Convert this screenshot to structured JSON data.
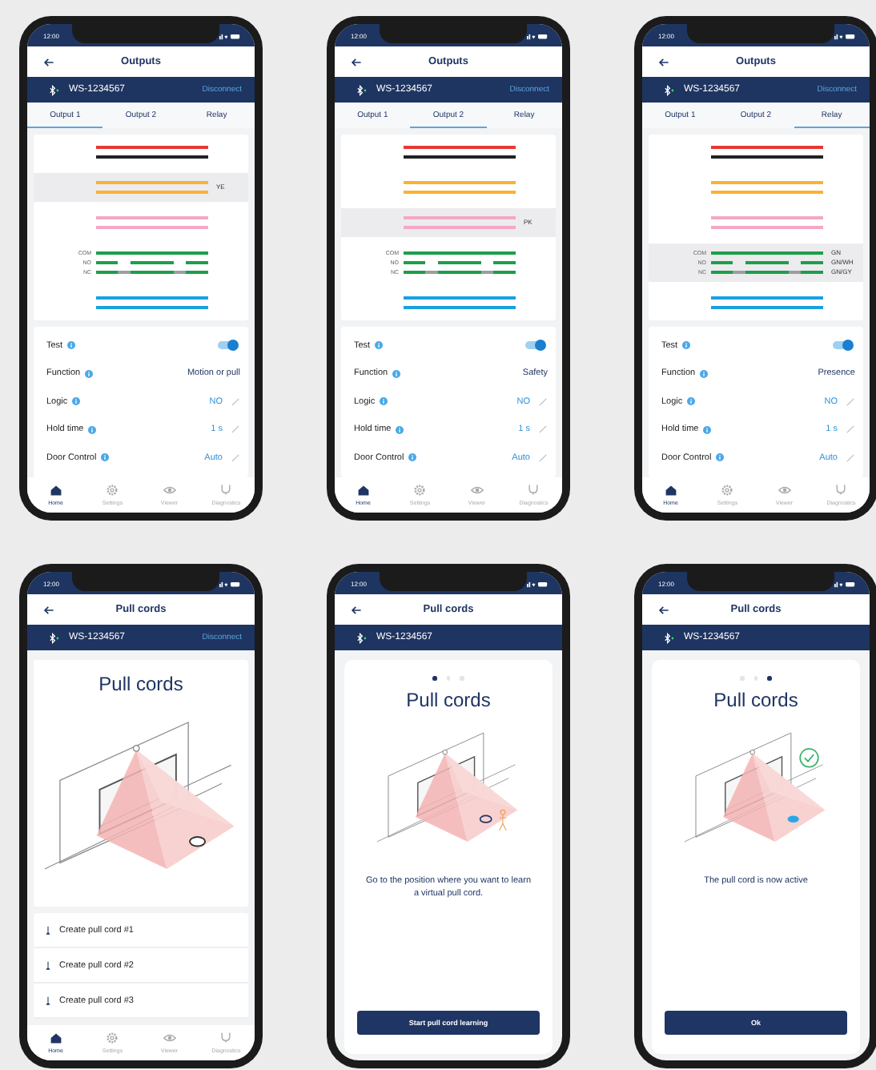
{
  "phones": [
    {
      "kind": "outputs",
      "status_time": "12:00",
      "title": "Outputs",
      "device": "WS-1234567",
      "disconnect": "Disconnect",
      "tabs": [
        {
          "label": "Output 1",
          "selected": true
        },
        {
          "label": "Output 2",
          "selected": false
        },
        {
          "label": "Relay",
          "selected": false
        }
      ],
      "wire_groups": [
        {
          "highlighted": false,
          "lines": [
            {
              "color": "#e53935",
              "kind": "solid"
            },
            {
              "color": "#222222",
              "kind": "solid"
            }
          ]
        },
        {
          "highlighted": true,
          "tags": [
            "YE"
          ],
          "lines": [
            {
              "color": "#f9b233",
              "kind": "solid"
            },
            {
              "color": "#f9b233",
              "kind": "solid"
            }
          ]
        },
        {
          "highlighted": false,
          "lines": [
            {
              "color": "#f4a7c6",
              "kind": "solid"
            },
            {
              "color": "#f4a7c6",
              "kind": "solid"
            }
          ]
        },
        {
          "highlighted": false,
          "lines": [
            {
              "color": "#1e9e4a",
              "kind": "solid",
              "label": "COM"
            },
            {
              "color": "#1e9e4a",
              "kind": "break",
              "label": "NO"
            },
            {
              "color": "#1e9e4a",
              "kind": "grey-break",
              "label": "NC"
            }
          ]
        },
        {
          "highlighted": false,
          "lines": [
            {
              "color": "#1aa0e0",
              "kind": "solid"
            },
            {
              "color": "#1aa0e0",
              "kind": "solid"
            }
          ]
        }
      ],
      "settings": [
        {
          "label": "Test",
          "kind": "toggle",
          "on": true
        },
        {
          "label": "Function",
          "kind": "value",
          "value": "Motion or pull"
        },
        {
          "label": "Logic",
          "kind": "edit",
          "value": "NO"
        },
        {
          "label": "Hold time",
          "kind": "edit",
          "value": "1 s"
        },
        {
          "label": "Door Control",
          "kind": "edit",
          "value": "Auto"
        }
      ],
      "nav": [
        {
          "label": "Home",
          "selected": true
        },
        {
          "label": "Settings",
          "selected": false
        },
        {
          "label": "Viewer",
          "selected": false
        },
        {
          "label": "Diagnostics",
          "selected": false
        }
      ]
    },
    {
      "kind": "outputs",
      "status_time": "12:00",
      "title": "Outputs",
      "device": "WS-1234567",
      "disconnect": "Disconnect",
      "tabs": [
        {
          "label": "Output 1",
          "selected": false
        },
        {
          "label": "Output 2",
          "selected": true
        },
        {
          "label": "Relay",
          "selected": false
        }
      ],
      "wire_groups": [
        {
          "highlighted": false,
          "lines": [
            {
              "color": "#e53935",
              "kind": "solid"
            },
            {
              "color": "#222222",
              "kind": "solid"
            }
          ]
        },
        {
          "highlighted": false,
          "lines": [
            {
              "color": "#f9b233",
              "kind": "solid"
            },
            {
              "color": "#f9b233",
              "kind": "solid"
            }
          ]
        },
        {
          "highlighted": true,
          "tags": [
            "PK"
          ],
          "lines": [
            {
              "color": "#f4a7c6",
              "kind": "solid"
            },
            {
              "color": "#f4a7c6",
              "kind": "solid"
            }
          ]
        },
        {
          "highlighted": false,
          "lines": [
            {
              "color": "#1e9e4a",
              "kind": "solid",
              "label": "COM"
            },
            {
              "color": "#1e9e4a",
              "kind": "break",
              "label": "NO"
            },
            {
              "color": "#1e9e4a",
              "kind": "grey-break",
              "label": "NC"
            }
          ]
        },
        {
          "highlighted": false,
          "lines": [
            {
              "color": "#1aa0e0",
              "kind": "solid"
            },
            {
              "color": "#1aa0e0",
              "kind": "solid"
            }
          ]
        }
      ],
      "settings": [
        {
          "label": "Test",
          "kind": "toggle",
          "on": true
        },
        {
          "label": "Function",
          "kind": "value",
          "value": "Safety"
        },
        {
          "label": "Logic",
          "kind": "edit",
          "value": "NO"
        },
        {
          "label": "Hold time",
          "kind": "edit",
          "value": "1 s"
        },
        {
          "label": "Door Control",
          "kind": "edit",
          "value": "Auto"
        }
      ],
      "nav": [
        {
          "label": "Home",
          "selected": true
        },
        {
          "label": "Settings",
          "selected": false
        },
        {
          "label": "Viewer",
          "selected": false
        },
        {
          "label": "Diagnostics",
          "selected": false
        }
      ]
    },
    {
      "kind": "outputs",
      "status_time": "12:00",
      "title": "Outputs",
      "device": "WS-1234567",
      "disconnect": "Disconnect",
      "tabs": [
        {
          "label": "Output 1",
          "selected": false
        },
        {
          "label": "Output 2",
          "selected": false
        },
        {
          "label": "Relay",
          "selected": true
        }
      ],
      "wire_groups": [
        {
          "highlighted": false,
          "lines": [
            {
              "color": "#e53935",
              "kind": "solid"
            },
            {
              "color": "#222222",
              "kind": "solid"
            }
          ]
        },
        {
          "highlighted": false,
          "lines": [
            {
              "color": "#f9b233",
              "kind": "solid"
            },
            {
              "color": "#f9b233",
              "kind": "solid"
            }
          ]
        },
        {
          "highlighted": false,
          "lines": [
            {
              "color": "#f4a7c6",
              "kind": "solid"
            },
            {
              "color": "#f4a7c6",
              "kind": "solid"
            }
          ]
        },
        {
          "highlighted": true,
          "tags": [
            "GN",
            "GN/WH",
            "GN/GY"
          ],
          "lines": [
            {
              "color": "#1e9e4a",
              "kind": "solid",
              "label": "COM"
            },
            {
              "color": "#1e9e4a",
              "kind": "break",
              "label": "NO"
            },
            {
              "color": "#1e9e4a",
              "kind": "grey-break",
              "label": "NC"
            }
          ]
        },
        {
          "highlighted": false,
          "lines": [
            {
              "color": "#1aa0e0",
              "kind": "solid"
            },
            {
              "color": "#1aa0e0",
              "kind": "solid"
            }
          ]
        }
      ],
      "settings": [
        {
          "label": "Test",
          "kind": "toggle",
          "on": true
        },
        {
          "label": "Function",
          "kind": "value",
          "value": "Presence"
        },
        {
          "label": "Logic",
          "kind": "edit",
          "value": "NO"
        },
        {
          "label": "Hold time",
          "kind": "edit",
          "value": "1 s"
        },
        {
          "label": "Door Control",
          "kind": "edit",
          "value": "Auto"
        }
      ],
      "nav": [
        {
          "label": "Home",
          "selected": true
        },
        {
          "label": "Settings",
          "selected": false
        },
        {
          "label": "Viewer",
          "selected": false
        },
        {
          "label": "Diagnostics",
          "selected": false
        }
      ]
    },
    {
      "kind": "pull-list",
      "status_time": "12:00",
      "title": "Pull cords",
      "device": "WS-1234567",
      "disconnect": "Disconnect",
      "heading": "Pull cords",
      "illustration": {
        "kind": "ring"
      },
      "items": [
        "Create pull cord #1",
        "Create pull cord #2",
        "Create pull cord #3"
      ],
      "nav": [
        {
          "label": "Home",
          "selected": true
        },
        {
          "label": "Settings",
          "selected": false
        },
        {
          "label": "Viewer",
          "selected": false
        },
        {
          "label": "Diagnostics",
          "selected": false
        }
      ]
    },
    {
      "kind": "pull-step",
      "status_time": "12:00",
      "title": "Pull cords",
      "device": "WS-1234567",
      "dots": [
        {
          "selected": true
        },
        {
          "selected": false
        },
        {
          "selected": false
        }
      ],
      "heading": "Pull cords",
      "illustration": {
        "kind": "ring-person"
      },
      "message": "Go to the position where you want to learn a virtual pull cord.",
      "button": "Start pull cord learning"
    },
    {
      "kind": "pull-step",
      "status_time": "12:00",
      "title": "Pull cords",
      "device": "WS-1234567",
      "dots": [
        {
          "selected": false
        },
        {
          "selected": false
        },
        {
          "selected": true
        }
      ],
      "heading": "Pull cords",
      "illustration": {
        "kind": "spot-check"
      },
      "message": "The pull cord is now active",
      "button": "Ok"
    }
  ]
}
